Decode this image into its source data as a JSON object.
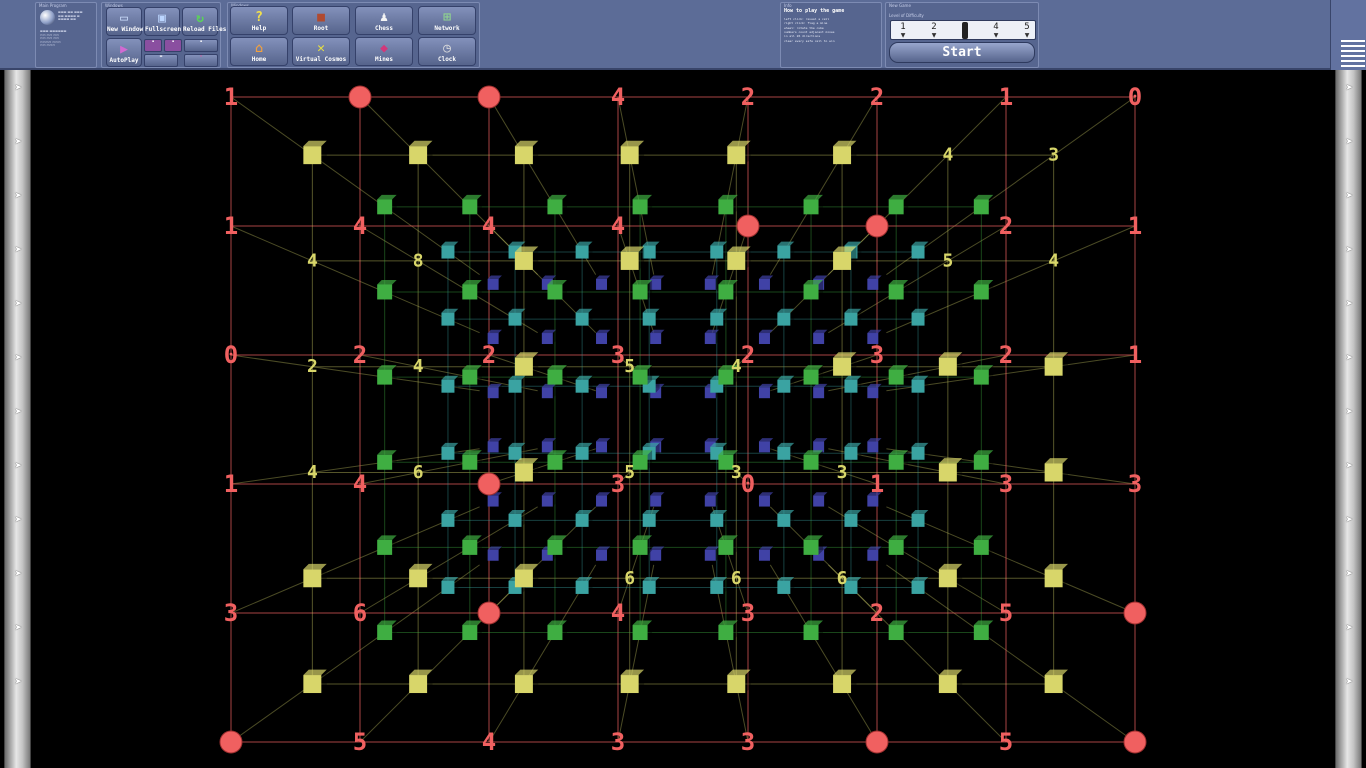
{
  "window": {
    "title": "MineSweeper 3D"
  },
  "info_panel": {
    "title": "How to play the game",
    "lines": [
      "left click: reveal a cell",
      "right click: flag a mine",
      "wheel: rotate the cube",
      "numbers count adjacent mines",
      "in all 26 directions",
      "clear every safe cell to win"
    ]
  },
  "panels": {
    "main": "Main Program",
    "windows": "Windows",
    "info": "Info",
    "new_game": "New Game",
    "difficulty": "Level of Difficulty"
  },
  "buttons": {
    "new_window": "New Window",
    "fullscreen": "Fullscreen",
    "reload_files": "Reload Files",
    "autoplay": "AutoPlay",
    "help": "Help",
    "root": "Root",
    "chess": "Chess",
    "network": "Network",
    "home": "Home",
    "virtual_cosmos": "Virtual Cosmos",
    "mines": "Mines",
    "clock": "Clock"
  },
  "difficulty": {
    "levels": [
      "1",
      "2",
      "3",
      "4",
      "5"
    ],
    "selected": 3
  },
  "start_label": "Start",
  "colors": {
    "red": "#f06060",
    "yellow": "#d8d66a",
    "green": "#3fae42",
    "teal": "#3aa3a2",
    "blue": "#4042a6",
    "toolbar": "#5c6c97"
  },
  "game": {
    "size": 8,
    "outer_numbers": [
      [
        "1",
        "M",
        "M",
        "4",
        "2",
        "2",
        "1",
        "0"
      ],
      [
        "1",
        "4",
        "4",
        "4",
        "M",
        "M",
        "2",
        "1"
      ],
      [
        "0",
        "2",
        "2",
        "3",
        "2",
        "3",
        "2",
        "1"
      ],
      [
        "1",
        "4",
        "M",
        "3",
        "0",
        "1",
        "3",
        "3"
      ],
      [
        "3",
        "6",
        "M",
        "4",
        "3",
        "2",
        "5",
        "M"
      ],
      [
        "M",
        "5",
        "4",
        "3",
        "3",
        "M",
        "5",
        "M"
      ]
    ],
    "second_layer": {
      "4_8": [
        "4",
        "8"
      ],
      "4_5": [
        "5",
        "4"
      ],
      "4_4": [
        "4",
        "3"
      ],
      "2_4": [
        "2",
        "4"
      ],
      "5_5": [
        "5",
        "4"
      ],
      "6": [
        "6",
        "6",
        "6"
      ],
      "3_6": [
        "3",
        "6"
      ],
      "4_3": [
        "3",
        "4"
      ]
    }
  },
  "menu_icon": "hamburger-menu-icon"
}
